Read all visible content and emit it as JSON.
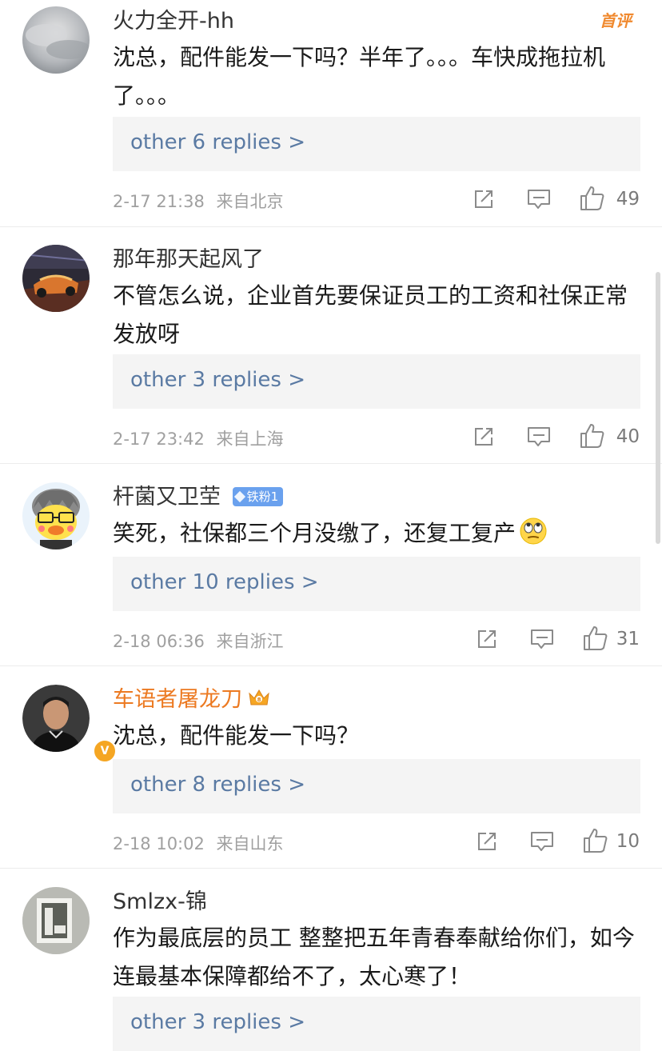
{
  "comments": [
    {
      "username": "火力全开-hh",
      "top_label": "首评",
      "text": "沈总，配件能发一下吗？半年了。。。车快成拖拉机了。。。",
      "replies": "other 6 replies >",
      "time": "2-17 21:38",
      "location": "来自北京",
      "likes": "49"
    },
    {
      "username": "那年那天起风了",
      "text": "不管怎么说，企业首先要保证员工的工资和社保正常发放呀",
      "replies": "other 3 replies >",
      "time": "2-17 23:42",
      "location": "来自上海",
      "likes": "40"
    },
    {
      "username": "杆菌又卫茔",
      "badge": "铁粉1",
      "text": "笑死，社保都三个月没缴了，还复工复产",
      "replies": "other 10 replies >",
      "time": "2-18 06:36",
      "location": "来自浙江",
      "likes": "31"
    },
    {
      "username": "车语者屠龙刀",
      "verified": "V",
      "text": "沈总，配件能发一下吗？",
      "replies": "other 8 replies >",
      "time": "2-18 10:02",
      "location": "来自山东",
      "likes": "10"
    },
    {
      "username": "Smlzx-锦",
      "text": "作为最底层的员工 整整把五年青春奉献给你们，如今连最基本保障都给不了，太心寒了！",
      "replies": "other 3 replies >"
    }
  ],
  "colors": {
    "link": "#5a7aa3",
    "meta": "#a0a0a0",
    "highlight_name": "#ec7a22",
    "reply_bg": "#f4f4f4",
    "badge": "#6aa1ee"
  },
  "icons": [
    "share-icon",
    "comment-icon",
    "like-icon",
    "crown-icon",
    "eye-roll-emoji-icon",
    "verified-badge-icon"
  ]
}
